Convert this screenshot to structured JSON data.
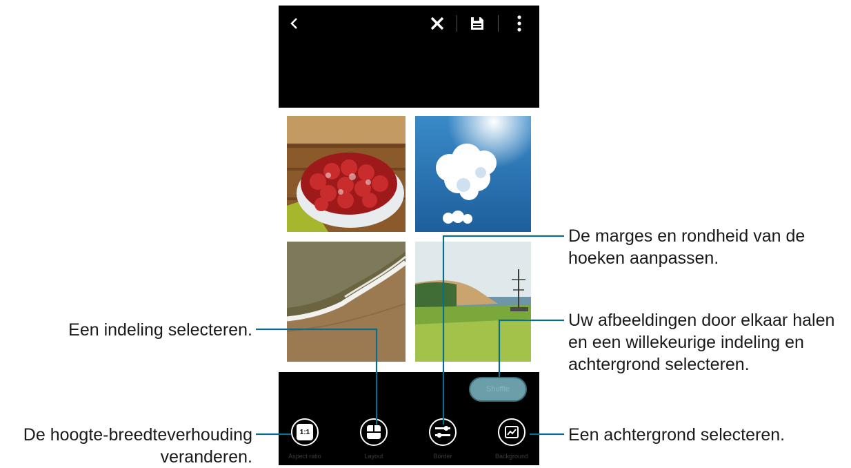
{
  "toolbar": {
    "icons": [
      "back-icon",
      "close-icon",
      "save-icon",
      "more-icon"
    ]
  },
  "photos": [
    {
      "name": "strawberry-tart"
    },
    {
      "name": "heart-cloud-sky"
    },
    {
      "name": "beach-waves"
    },
    {
      "name": "coast-landscape"
    }
  ],
  "shuffle": {
    "label": "Shuffle"
  },
  "tools": [
    {
      "label": "Aspect ratio",
      "icon": "aspect-ratio-icon",
      "glyph": "1:1"
    },
    {
      "label": "Layout",
      "icon": "layout-icon"
    },
    {
      "label": "Border",
      "icon": "border-icon"
    },
    {
      "label": "Background",
      "icon": "background-icon"
    }
  ],
  "annotations": {
    "border": "De marges en rondheid van de hoeken aanpassen.",
    "shuffle": "Uw afbeeldingen door elkaar halen en een willekeurige indeling en achtergrond selecteren.",
    "layout": "Een indeling selecteren.",
    "aspect_ratio": "De hoogte-breedteverhouding veranderen.",
    "background": "Een achtergrond selecteren."
  },
  "colors": {
    "leader_line": "#0a6e8a",
    "shuffle_button": "#6b9ea8"
  }
}
